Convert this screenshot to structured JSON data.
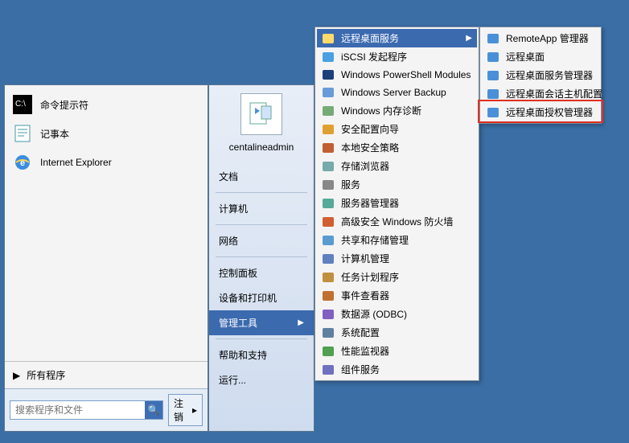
{
  "pinned": [
    {
      "label": "命令提示符",
      "icon": "cmd"
    },
    {
      "label": "记事本",
      "icon": "notepad"
    },
    {
      "label": "Internet Explorer",
      "icon": "ie"
    }
  ],
  "all_programs_label": "所有程序",
  "search_placeholder": "搜索程序和文件",
  "logoff_label": "注销",
  "username": "centalineadmin",
  "nav": {
    "docs": "文档",
    "computer": "计算机",
    "network": "网络",
    "control": "控制面板",
    "devices": "设备和打印机",
    "admin_tools": "管理工具",
    "help": "帮助和支持",
    "run": "运行..."
  },
  "admin_submenu": [
    {
      "label": "远程桌面服务",
      "has_sub": true,
      "active": true,
      "icon": "folder"
    },
    {
      "label": "iSCSI 发起程序",
      "icon": "globe"
    },
    {
      "label": "Windows PowerShell Modules",
      "icon": "ps"
    },
    {
      "label": "Windows Server Backup",
      "icon": "backup"
    },
    {
      "label": "Windows 内存诊断",
      "icon": "mem"
    },
    {
      "label": "安全配置向导",
      "icon": "shield"
    },
    {
      "label": "本地安全策略",
      "icon": "policy"
    },
    {
      "label": "存储浏览器",
      "icon": "storage"
    },
    {
      "label": "服务",
      "icon": "gear"
    },
    {
      "label": "服务器管理器",
      "icon": "server"
    },
    {
      "label": "高级安全 Windows 防火墙",
      "icon": "firewall"
    },
    {
      "label": "共享和存储管理",
      "icon": "share"
    },
    {
      "label": "计算机管理",
      "icon": "mgmt"
    },
    {
      "label": "任务计划程序",
      "icon": "task"
    },
    {
      "label": "事件查看器",
      "icon": "event"
    },
    {
      "label": "数据源 (ODBC)",
      "icon": "odbc"
    },
    {
      "label": "系统配置",
      "icon": "sysconf"
    },
    {
      "label": "性能监视器",
      "icon": "perf"
    },
    {
      "label": "组件服务",
      "icon": "comp"
    }
  ],
  "rds_submenu": [
    {
      "label": "RemoteApp 管理器",
      "icon": "rds"
    },
    {
      "label": "远程桌面",
      "icon": "rds"
    },
    {
      "label": "远程桌面服务管理器",
      "icon": "rds"
    },
    {
      "label": "远程桌面会话主机配置",
      "icon": "rds"
    },
    {
      "label": "远程桌面授权管理器",
      "icon": "rds",
      "highlighted": true
    }
  ]
}
